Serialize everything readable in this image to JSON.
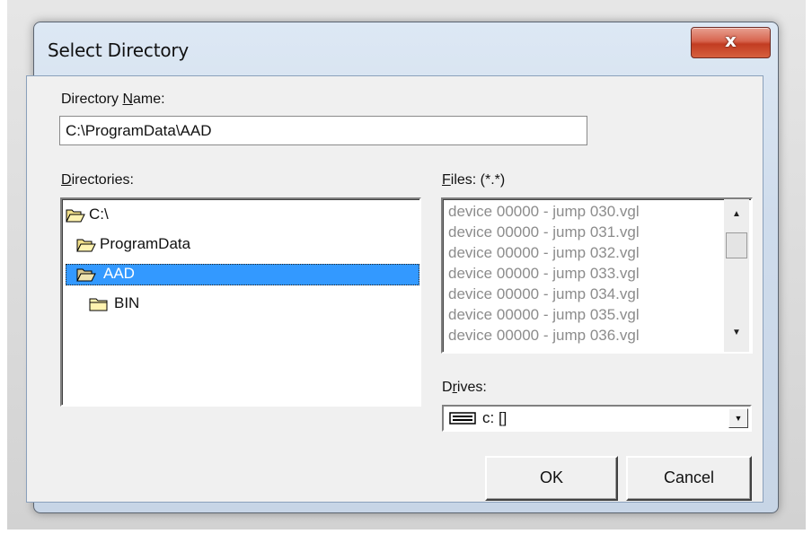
{
  "window": {
    "title": "Select Directory",
    "close_glyph": "x"
  },
  "directory_name": {
    "label_pre": "Directory ",
    "label_ul": "N",
    "label_post": "ame:",
    "value": "C:\\ProgramData\\AAD"
  },
  "directories": {
    "label_ul": "D",
    "label_post": "irectories:",
    "items": [
      {
        "label": "C:\\",
        "icon": "open-folder-icon"
      },
      {
        "label": "ProgramData",
        "icon": "open-folder-icon"
      },
      {
        "label": "AAD",
        "icon": "open-folder-icon",
        "selected": true
      },
      {
        "label": "BIN",
        "icon": "closed-folder-icon"
      }
    ]
  },
  "files": {
    "label_ul": "F",
    "label_post": "iles: (*.*)",
    "items": [
      "device 00000 - jump 030.vgl",
      "device 00000 - jump 031.vgl",
      "device 00000 - jump 032.vgl",
      "device 00000 - jump 033.vgl",
      "device 00000 - jump 034.vgl",
      "device 00000 - jump 035.vgl",
      "device 00000 - jump 036.vgl"
    ]
  },
  "drives": {
    "label_pre": "D",
    "label_ul": "r",
    "label_post": "ives:",
    "value": "c: []",
    "icon": "drive-icon"
  },
  "buttons": {
    "ok": "OK",
    "cancel": "Cancel"
  },
  "colors": {
    "selection": "#3399ff",
    "close": "#c23c22",
    "disabled_text": "#8c8c8c"
  }
}
